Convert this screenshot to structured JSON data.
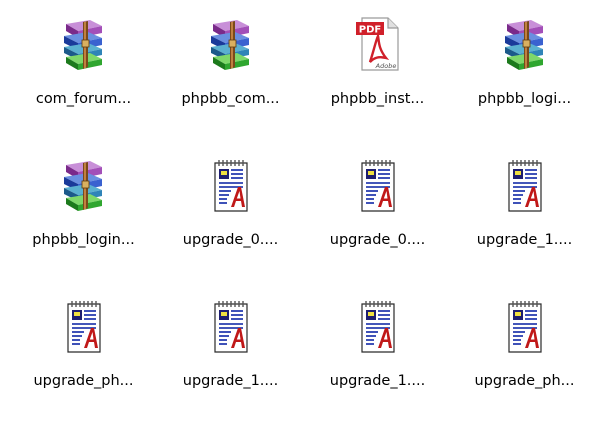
{
  "files": [
    {
      "name": "com_forum...",
      "icon": "rar-archive-icon"
    },
    {
      "name": "phpbb_com...",
      "icon": "rar-archive-icon"
    },
    {
      "name": "phpbb_inst...",
      "icon": "pdf-document-icon"
    },
    {
      "name": "phpbb_logi...",
      "icon": "rar-archive-icon"
    },
    {
      "name": "phpbb_login...",
      "icon": "rar-archive-icon"
    },
    {
      "name": "upgrade_0....",
      "icon": "text-document-icon"
    },
    {
      "name": "upgrade_0....",
      "icon": "text-document-icon"
    },
    {
      "name": "upgrade_1....",
      "icon": "text-document-icon"
    },
    {
      "name": "upgrade_ph...",
      "icon": "text-document-icon"
    },
    {
      "name": "upgrade_1....",
      "icon": "text-document-icon"
    },
    {
      "name": "upgrade_1....",
      "icon": "text-document-icon"
    },
    {
      "name": "upgrade_ph...",
      "icon": "text-document-icon"
    }
  ],
  "pdf_badge_text": "PDF",
  "pdf_brand_text": "Adobe",
  "colors": {
    "background": "#ffffff",
    "label_text": "#000000",
    "pdf_red": "#d0202a",
    "doc_blue": "#2a3fb0",
    "doc_red": "#c01818"
  }
}
